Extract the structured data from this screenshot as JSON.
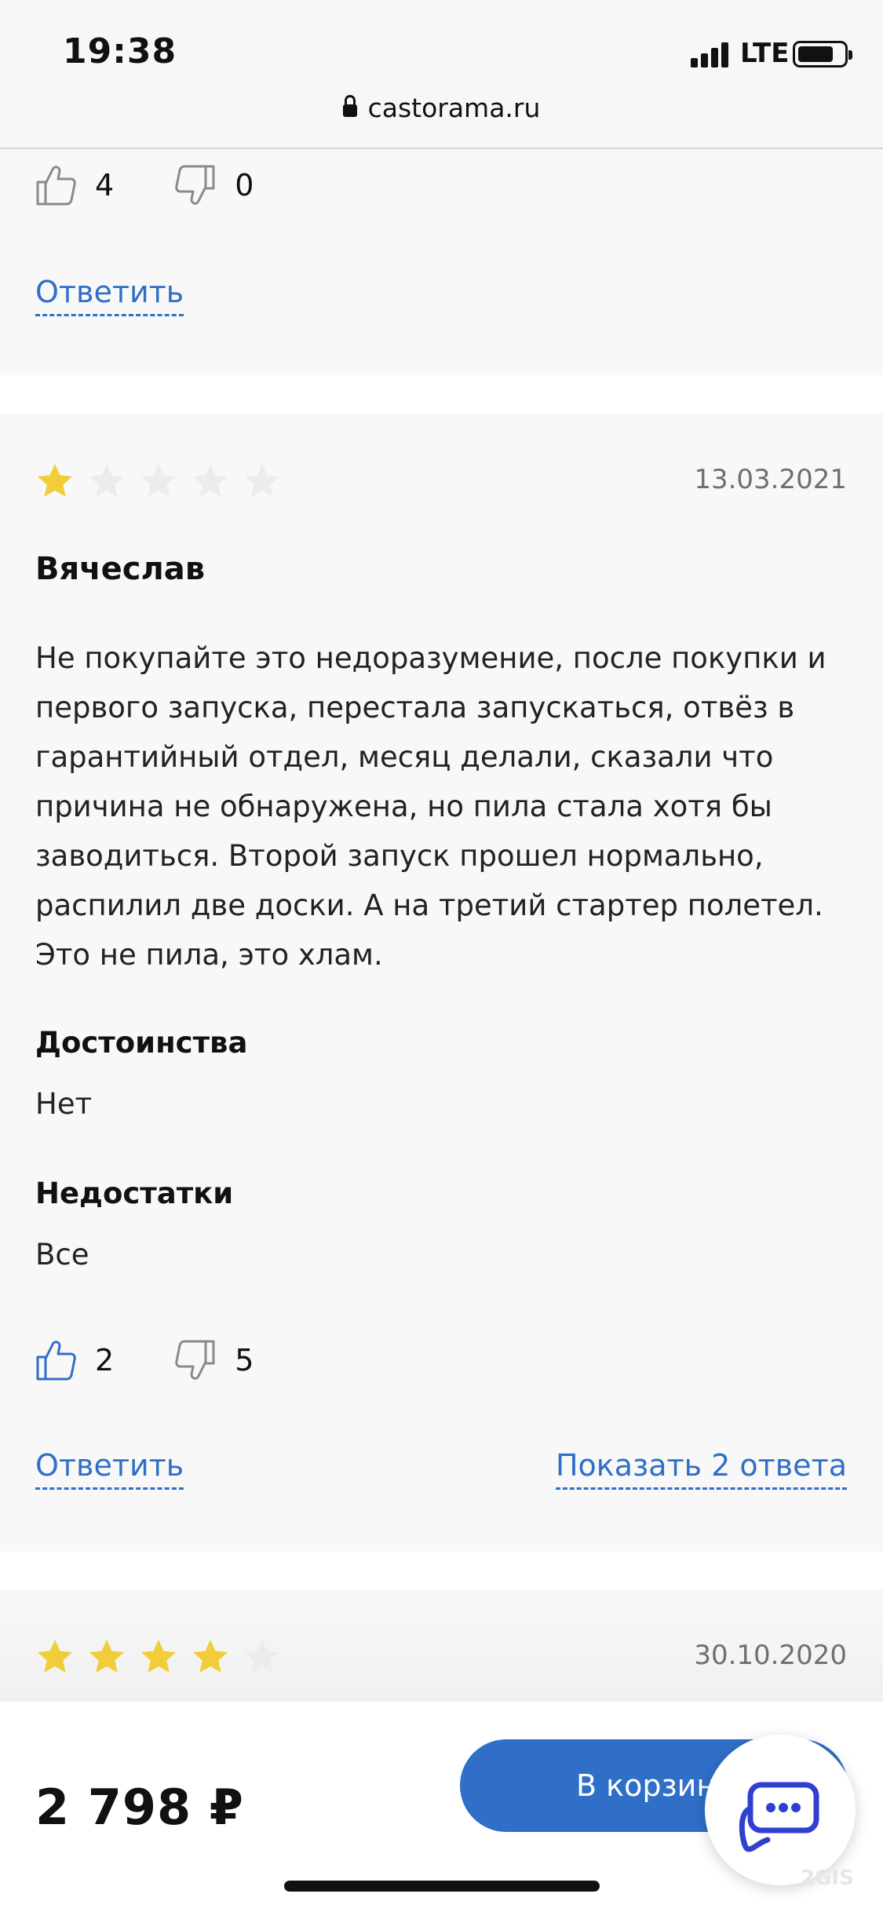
{
  "status_bar": {
    "time": "19:38",
    "network": "LTE",
    "url": "castorama.ru"
  },
  "reviews": [
    {
      "likes": "4",
      "dislikes": "0",
      "reply_label": "Ответить"
    },
    {
      "rating": 1,
      "rating_max": 5,
      "date": "13.03.2021",
      "author": "Вячеслав",
      "text": "Не покупайте это недоразумение, после покупки и первого запуска, перестала запускаться, отвёз в гарантийный отдел, месяц делали, сказали что причина не обнаружена, но пила стала хотя бы заводиться. Второй запуск прошел нормально, распилил две доски. А на третий стартер полетел. Это не пила, это хлам.",
      "pros_title": "Достоинства",
      "pros": "Нет",
      "cons_title": "Недостатки",
      "cons": "Все",
      "likes": "2",
      "dislikes": "5",
      "reply_label": "Ответить",
      "show_replies_label": "Показать 2 ответа"
    },
    {
      "rating": 4,
      "rating_max": 5,
      "date": "30.10.2020"
    }
  ],
  "bottom_bar": {
    "price": "2 798 ₽",
    "cart_button": "В корзину"
  },
  "watermark": "2GIS",
  "colors": {
    "accent": "#2f6fc7",
    "star_filled": "#f2cd3a",
    "star_empty": "#ececec",
    "card_bg": "#f8f8f8"
  },
  "icons": [
    "thumbs-up-icon",
    "thumbs-down-icon",
    "star-icon",
    "chat-icon",
    "lock-icon"
  ]
}
